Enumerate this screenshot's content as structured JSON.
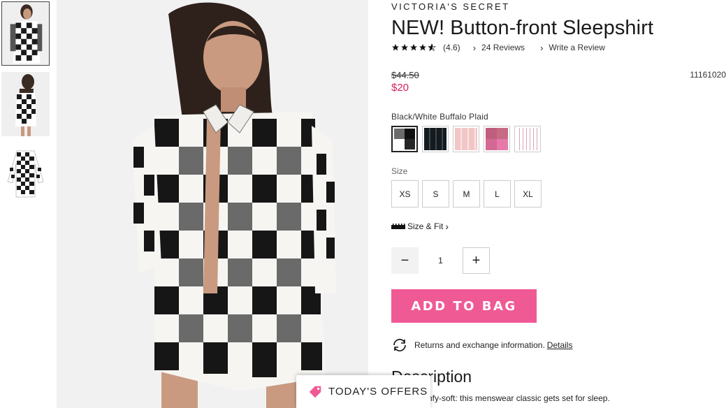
{
  "product": {
    "brand": "VICTORIA'S SECRET",
    "title": "NEW! Button-front Sleepshirt",
    "rating_value": 4.6,
    "rating_text": "(4.6)",
    "reviews_link": "24 Reviews",
    "write_review_link": "Write a Review",
    "original_price": "$44.50",
    "sale_price": "$20",
    "sku": "11161020"
  },
  "colors": {
    "selected_label": "Black/White Buffalo Plaid",
    "swatches": [
      {
        "name": "black-white-buffalo-plaid",
        "selected": true
      },
      {
        "name": "black-stripe",
        "selected": false
      },
      {
        "name": "pink-stripe",
        "selected": false
      },
      {
        "name": "pink-plaid",
        "selected": false
      },
      {
        "name": "white-pink-stripe",
        "selected": false
      }
    ]
  },
  "sizes": {
    "label": "Size",
    "options": [
      "XS",
      "S",
      "M",
      "L",
      "XL"
    ]
  },
  "size_fit": {
    "label": "Size & Fit",
    "chevron": "›"
  },
  "quantity": {
    "minus": "−",
    "value": "1",
    "plus": "+"
  },
  "add_to_bag": {
    "label": "ADD TO BAG",
    "color": "#ef5a95"
  },
  "returns": {
    "text": "Returns and exchange information.",
    "details_link": "Details"
  },
  "description": {
    "heading": "Description",
    "text": "chic & comfy-soft: this menswear classic gets set for sleep."
  },
  "offers": {
    "label": "TODAY'S OFFERS"
  },
  "icons": {
    "star": "star-icon",
    "chevron": "chevron-right-icon",
    "ruler": "ruler-icon",
    "returns": "returns-exchange-icon",
    "tag": "tag-icon"
  },
  "colors_theme": {
    "sale_price": "#d21f5f",
    "accent": "#ef5a95"
  }
}
